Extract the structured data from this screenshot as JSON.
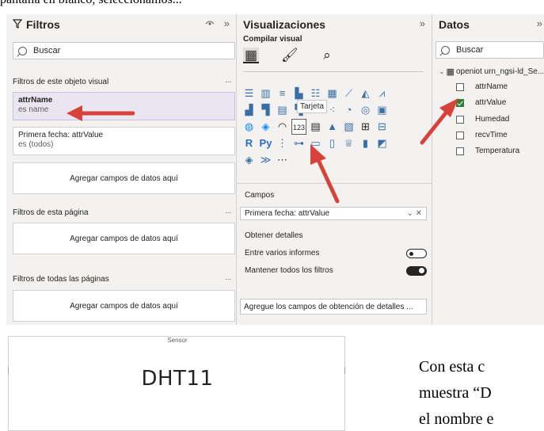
{
  "top_text": "pantalla en blanco, seleccionamos...",
  "filters": {
    "title": "Filtros",
    "search_placeholder": "Buscar",
    "visual_section": "Filtros de este objeto visual",
    "filter1": {
      "name": "attrName",
      "value": "es name"
    },
    "filter2": {
      "name": "Primera fecha: attrValue",
      "value": "es (todos)"
    },
    "add_fields": "Agregar campos de datos aquí",
    "page_section": "Filtros de esta página",
    "all_pages_section": "Filtros de todas las páginas",
    "more": "..."
  },
  "visualizations": {
    "title": "Visualizaciones",
    "subtitle": "Compilar visual",
    "tooltip": "Tarjeta",
    "card_icon_text": "123",
    "r_label": "R",
    "py_label": "Py",
    "fields_label": "Campos",
    "field_value": "Primera fecha: attrValue",
    "details_label": "Obtener detalles",
    "toggle1_label": "Entre varios informes",
    "toggle1_on": false,
    "toggle2_label": "Mantener todos los filtros",
    "toggle2_on": true,
    "details_drop": "Agregue los campos de obtención de detalles ..."
  },
  "data": {
    "title": "Datos",
    "search_placeholder": "Buscar",
    "table_name": "openiot urn_ngsi-ld_Se...",
    "fields": [
      {
        "name": "attrName",
        "checked": false
      },
      {
        "name": "attrValue",
        "checked": true
      },
      {
        "name": "Humedad",
        "checked": false
      },
      {
        "name": "recvTime",
        "checked": false
      },
      {
        "name": "Temperatura",
        "checked": false
      }
    ]
  },
  "sensor_card": {
    "title": "Sensor",
    "value": "DHT11"
  },
  "doc_text": {
    "line1": "Con esta c",
    "line2": "muestra “D",
    "line3": "el nombre e"
  },
  "colors": {
    "arrow": "#d9423b",
    "selected_filter": "#e9e6f2",
    "check": "#2e7d32"
  }
}
